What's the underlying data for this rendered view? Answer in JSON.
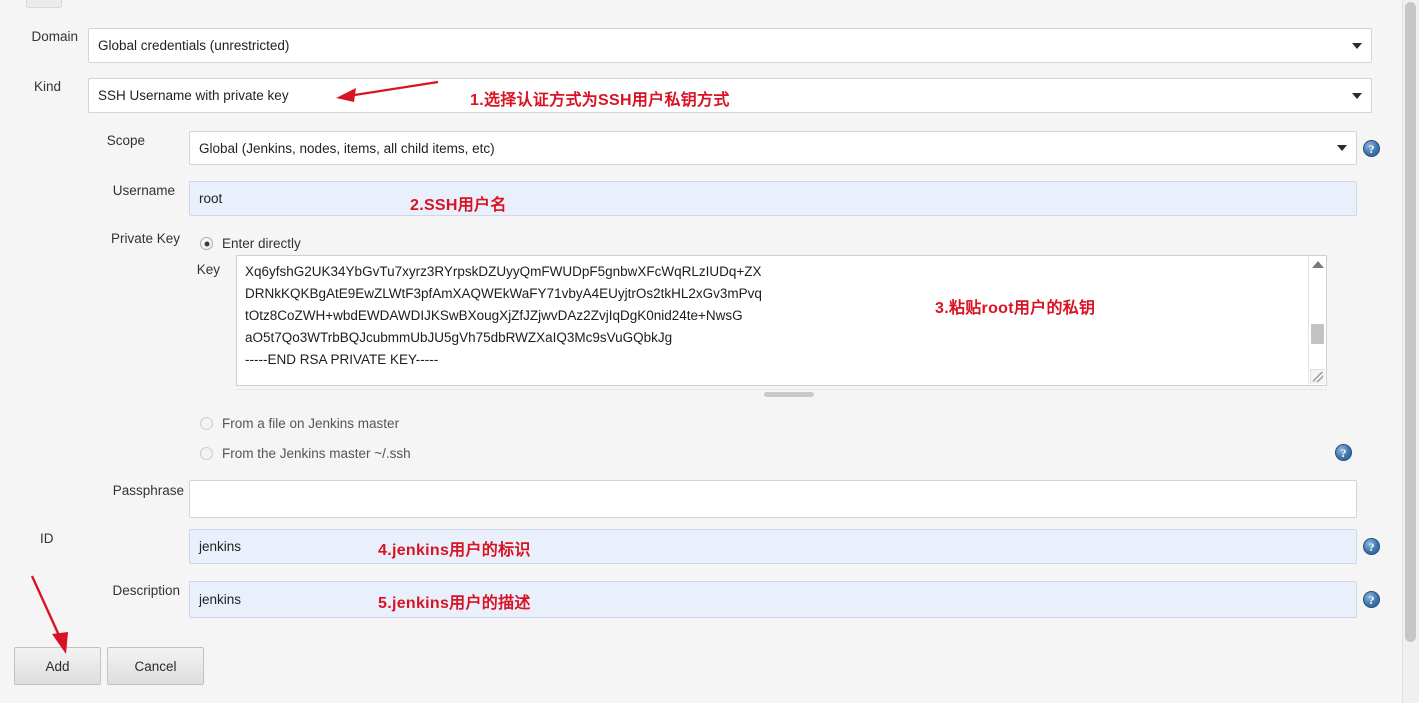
{
  "form": {
    "rows": [
      {
        "label": "Domain",
        "value": "Global credentials (unrestricted)"
      },
      {
        "label": "Kind",
        "value": "SSH Username with private key"
      },
      {
        "label": "Scope",
        "value": "Global (Jenkins, nodes, items, all child items, etc)"
      },
      {
        "label": "Username",
        "value": "root"
      },
      {
        "label": "Private Key",
        "value": ""
      },
      {
        "label": "Key",
        "value": ""
      },
      {
        "label": "Passphrase",
        "value": ""
      },
      {
        "label": "ID",
        "value": "jenkins"
      },
      {
        "label": "Description",
        "value": "jenkins"
      }
    ],
    "private_key": {
      "label": "Private Key",
      "key_label": "Key",
      "options": [
        {
          "label": "Enter directly",
          "selected": true
        },
        {
          "label": "From a file on Jenkins master",
          "selected": false
        },
        {
          "label": "From the Jenkins master ~/.ssh",
          "selected": false
        }
      ],
      "key_text": "Xq6yfshG2UK34YbGvTu7xyrz3RYrpskDZUyyQmFWUDpF5gnbwXFcWqRLzIUDq+ZX\nDRNkKQKBgAtE9EwZLWtF3pfAmXAQWEkWaFY71vbyA4EUyjtrOs2tkHL2xGv3mPvq\ntOtz8CoZWH+wbdEWDAWDIJKSwBXougXjZfJZjwvDAz2ZvjIqDgK0nid24te+NwsG\naO5t7Qo3WTrbBQJcubmmUbJU5gVh75dbRWZXaIQ3Mc9sVuGQbkJg\n-----END RSA PRIVATE KEY-----"
    },
    "help_symbol": "?"
  },
  "buttons": {
    "add": "Add",
    "cancel": "Cancel"
  },
  "annotations": [
    {
      "id": 1,
      "text": "1.选择认证方式为SSH用户私钥方式"
    },
    {
      "id": 2,
      "text": "2.SSH用户名"
    },
    {
      "id": 3,
      "text": "3.粘贴root用户的私钥"
    },
    {
      "id": 4,
      "text": "4.jenkins用户的标识"
    },
    {
      "id": 5,
      "text": "5.jenkins用户的描述"
    }
  ],
  "colors": {
    "annotation_red": "#d81323",
    "filled_field_bg": "#eaf0fb",
    "page_bg": "#f5f5f5"
  }
}
